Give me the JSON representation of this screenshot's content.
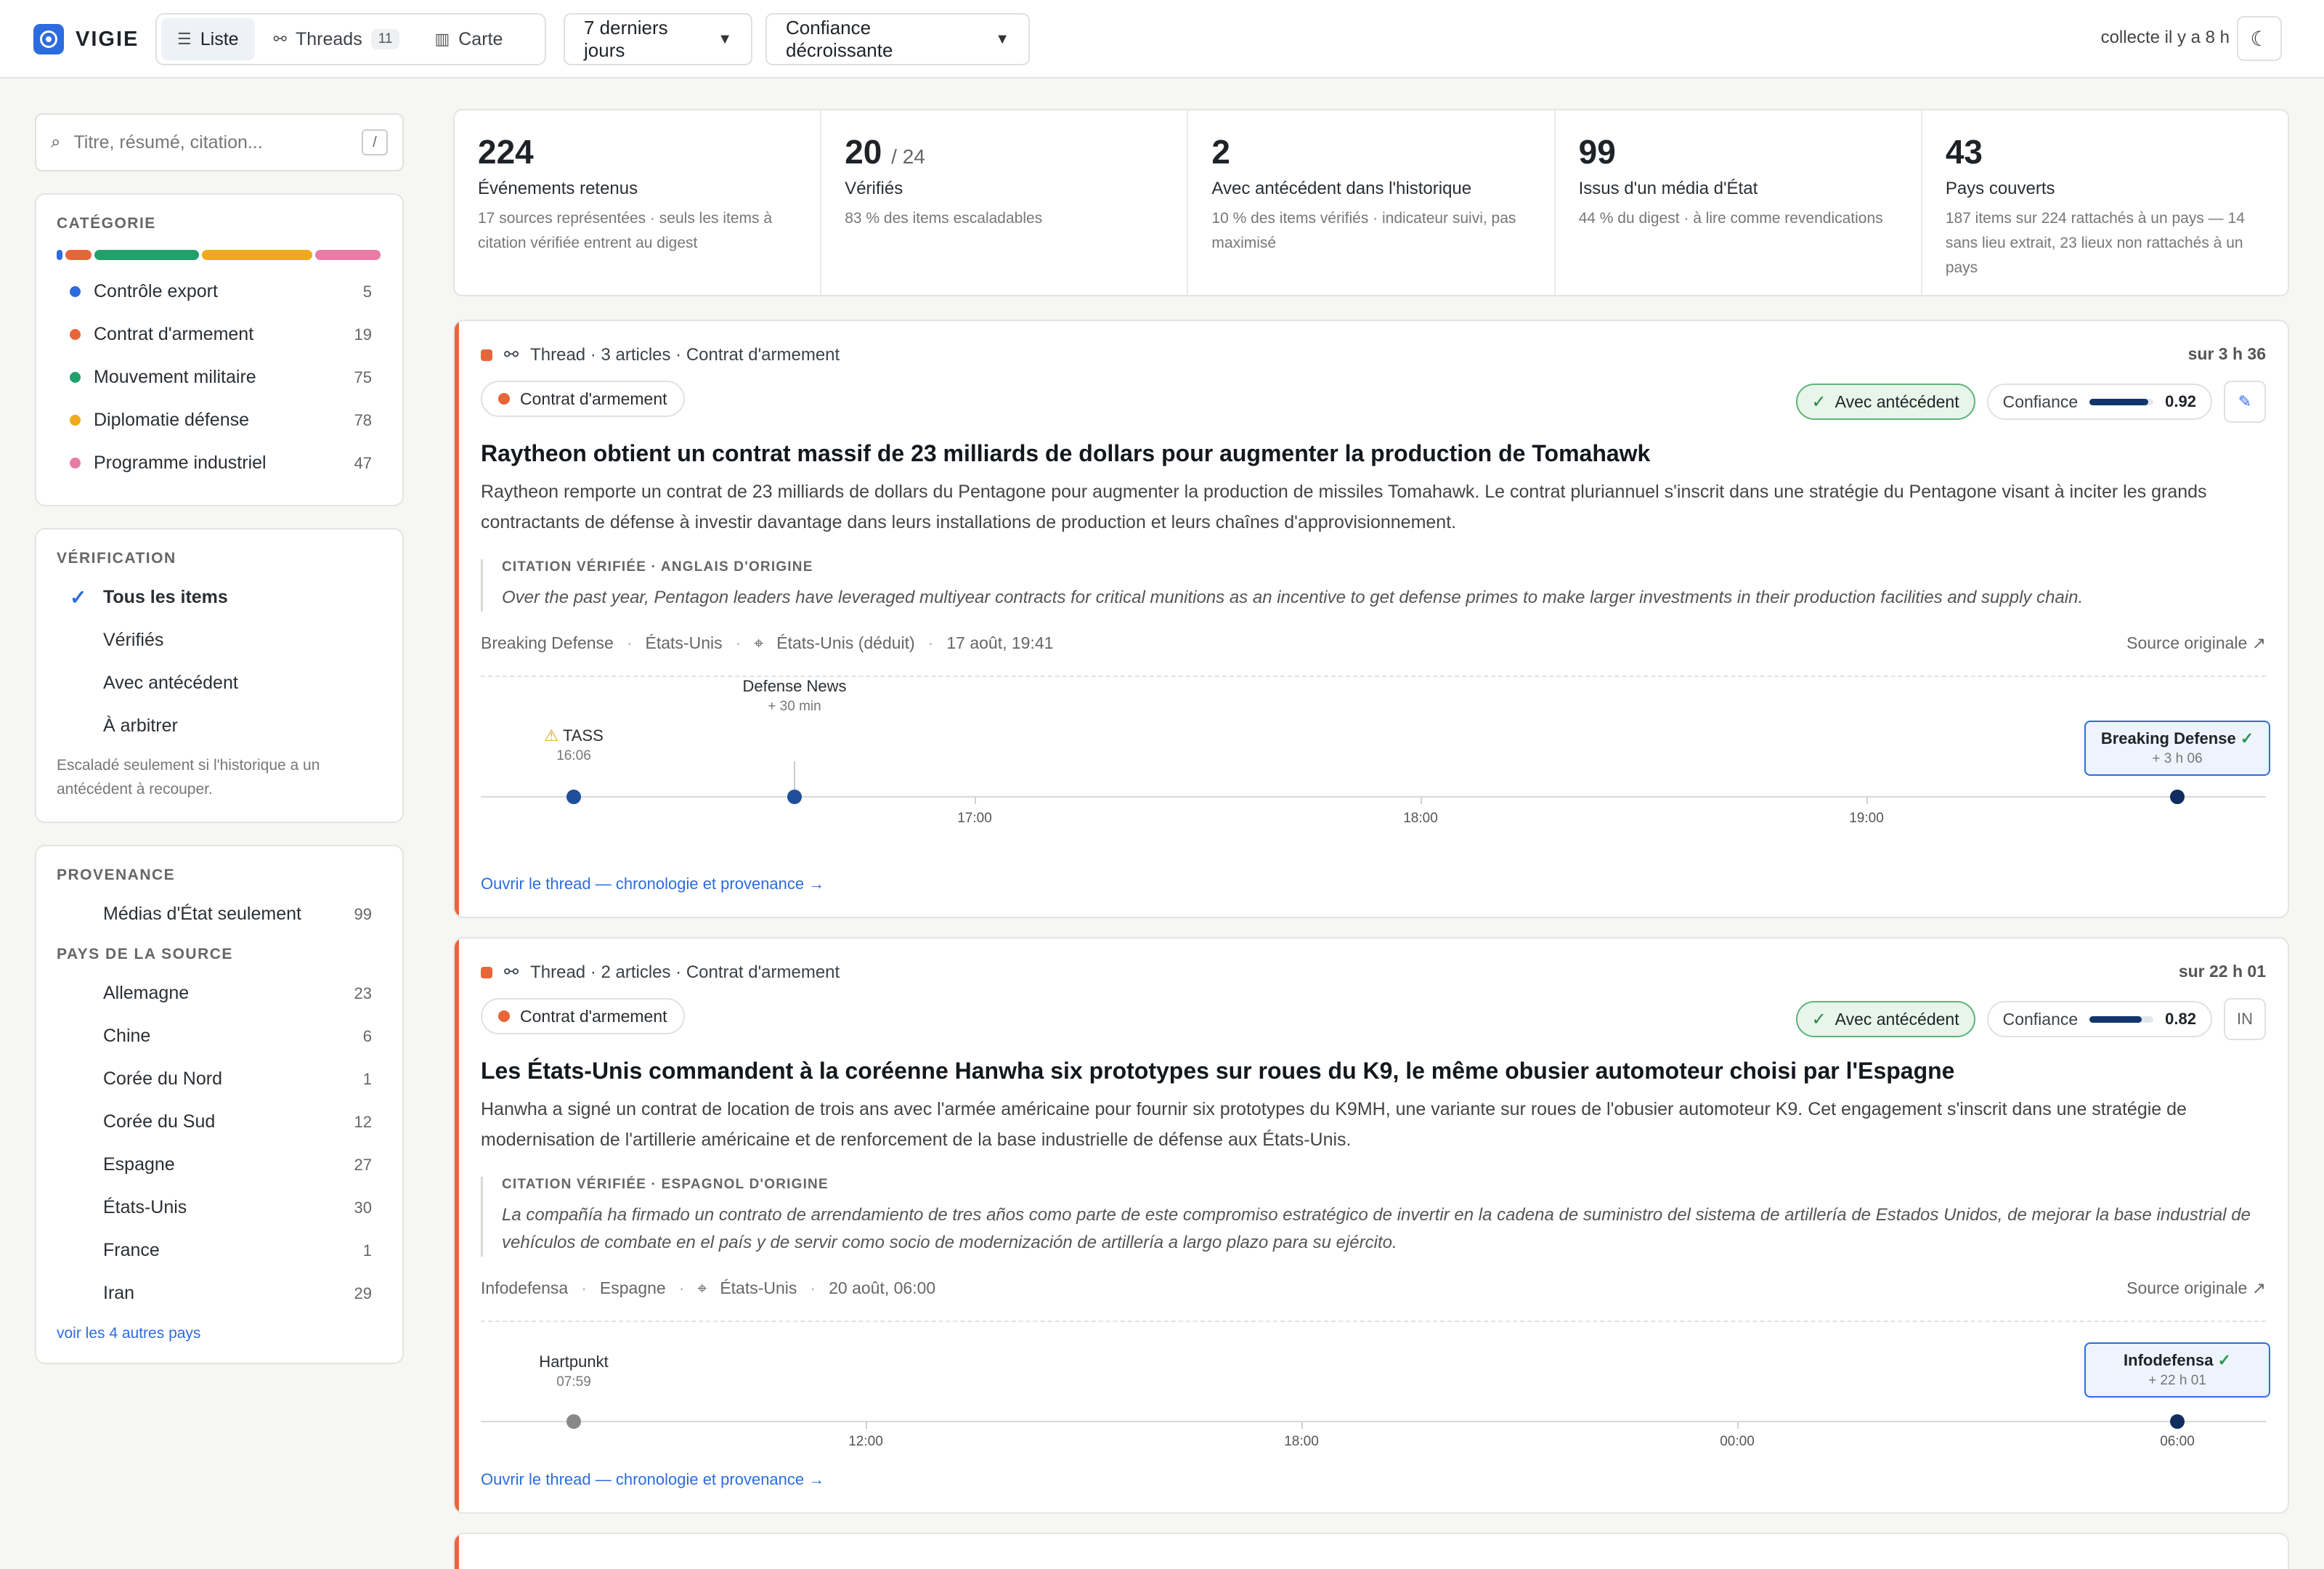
{
  "app": {
    "name": "VIGIE"
  },
  "nav": {
    "tabs": [
      {
        "label": "Liste",
        "icon": "list-icon"
      },
      {
        "label": "Threads",
        "count": "11",
        "icon": "thread-icon"
      },
      {
        "label": "Carte",
        "icon": "map-icon"
      }
    ],
    "period": "7 derniers jours",
    "sort": "Confiance décroissante",
    "collected": "collecte il y a 8 h"
  },
  "sidebar": {
    "search_placeholder": "Titre, résumé, citation...",
    "search_shortcut": "/",
    "category": {
      "heading": "CATÉGORIE",
      "items": [
        {
          "label": "Contrôle export",
          "count": "5",
          "color": "#2d6cdf"
        },
        {
          "label": "Contrat d'armement",
          "count": "19",
          "color": "#e8653a"
        },
        {
          "label": "Mouvement militaire",
          "count": "75",
          "color": "#22a06b"
        },
        {
          "label": "Diplomatie défense",
          "count": "78",
          "color": "#f0a91a"
        },
        {
          "label": "Programme industriel",
          "count": "47",
          "color": "#e87ca5"
        }
      ]
    },
    "verification": {
      "heading": "VÉRIFICATION",
      "items": [
        {
          "label": "Tous les items"
        },
        {
          "label": "Vérifiés"
        },
        {
          "label": "Avec antécédent"
        },
        {
          "label": "À arbitrer"
        }
      ],
      "note": "Escaladé seulement si l'historique a un antécédent à recouper."
    },
    "provenance": {
      "heading": "PROVENANCE",
      "state_media": {
        "label": "Médias d'État seulement",
        "count": "99"
      },
      "country_heading": "PAYS DE LA SOURCE",
      "countries": [
        {
          "label": "Allemagne",
          "count": "23"
        },
        {
          "label": "Chine",
          "count": "6"
        },
        {
          "label": "Corée du Nord",
          "count": "1"
        },
        {
          "label": "Corée du Sud",
          "count": "12"
        },
        {
          "label": "Espagne",
          "count": "27"
        },
        {
          "label": "États-Unis",
          "count": "30"
        },
        {
          "label": "France",
          "count": "1"
        },
        {
          "label": "Iran",
          "count": "29"
        }
      ],
      "more": "voir les 4 autres pays"
    }
  },
  "stats": [
    {
      "value": "224",
      "label": "Événements retenus",
      "sub": "17 sources représentées · seuls les items à citation vérifiée entrent au digest"
    },
    {
      "value": "20",
      "suffix": "/ 24",
      "label": "Vérifiés",
      "sub": "83 % des items escaladables"
    },
    {
      "value": "2",
      "label": "Avec antécédent dans l'historique",
      "sub": "10 % des items vérifiés · indicateur suivi, pas maximisé"
    },
    {
      "value": "99",
      "label": "Issus d'un média d'État",
      "sub": "44 % du digest · à lire comme revendications"
    },
    {
      "value": "43",
      "label": "Pays couverts",
      "sub": "187 items sur 224 rattachés à un pays — 14 sans lieu extrait, 23 lieux non rattachés à un pays"
    }
  ],
  "cards": [
    {
      "thread": "Thread · 3 articles · Contrat d'armement",
      "duration": "sur 3 h 36",
      "category": "Contrat d'armement",
      "badge": "Avec antécédent",
      "confidence_label": "Confiance",
      "confidence": "0.92",
      "title": "Raytheon obtient un contrat massif de 23 milliards de dollars pour augmenter la production de Tomahawk",
      "summary": "Raytheon remporte un contrat de 23 milliards de dollars du Pentagone pour augmenter la production de missiles Tomahawk. Le contrat pluriannuel s'inscrit dans une stratégie du Pentagone visant à inciter les grands contractants de défense à investir davantage dans leurs installations de production et leurs chaînes d'approvisionnement.",
      "quote_head": "CITATION VÉRIFIÉE · ANGLAIS D'ORIGINE",
      "quote": "Over the past year, Pentagon leaders have leveraged multiyear contracts for critical munitions as an incentive to get defense primes to make larger investments in their production facilities and supply chain.",
      "source": "Breaking Defense",
      "country": "États-Unis",
      "place": "États-Unis (déduit)",
      "date": "17 août, 19:41",
      "source_link": "Source originale ↗",
      "ticks": [
        "17:00",
        "18:00",
        "19:00"
      ],
      "events": [
        {
          "source": "TASS",
          "time": "16:06"
        },
        {
          "source": "Defense News",
          "time": "+ 30 min"
        },
        {
          "source": "Breaking Defense",
          "time": "+ 3 h 06"
        }
      ],
      "open_link": "Ouvrir le thread — chronologie et provenance →"
    },
    {
      "thread": "Thread · 2 articles · Contrat d'armement",
      "duration": "sur 22 h 01",
      "category": "Contrat d'armement",
      "badge": "Avec antécédent",
      "confidence_label": "Confiance",
      "confidence": "0.82",
      "lang_btn": "IN",
      "title": "Les États-Unis commandent à la coréenne Hanwha six prototypes sur roues du K9, le même obusier automoteur choisi par l'Espagne",
      "summary": "Hanwha a signé un contrat de location de trois ans avec l'armée américaine pour fournir six prototypes du K9MH, une variante sur roues de l'obusier automoteur K9. Cet engagement s'inscrit dans une stratégie de modernisation de l'artillerie américaine et de renforcement de la base industrielle de défense aux États-Unis.",
      "quote_head": "CITATION VÉRIFIÉE · ESPAGNOL D'ORIGINE",
      "quote": "La compañía ha firmado un contrato de arrendamiento de tres años como parte de este compromiso estratégico de invertir en la cadena de suministro del sistema de artillería de Estados Unidos, de mejorar la base industrial de vehículos de combate en el país y de servir como socio de modernización de artillería a largo plazo para su ejército.",
      "source": "Infodefensa",
      "country": "Espagne",
      "place": "États-Unis",
      "date": "20 août, 06:00",
      "source_link": "Source originale ↗",
      "ticks": [
        "12:00",
        "18:00",
        "00:00",
        "06:00"
      ],
      "events": [
        {
          "source": "Hartpunkt",
          "time": "07:59"
        },
        {
          "source": "Infodefensa",
          "time": "+ 22 h 01"
        }
      ],
      "open_link": "Ouvrir le thread — chronologie et provenance →"
    }
  ]
}
